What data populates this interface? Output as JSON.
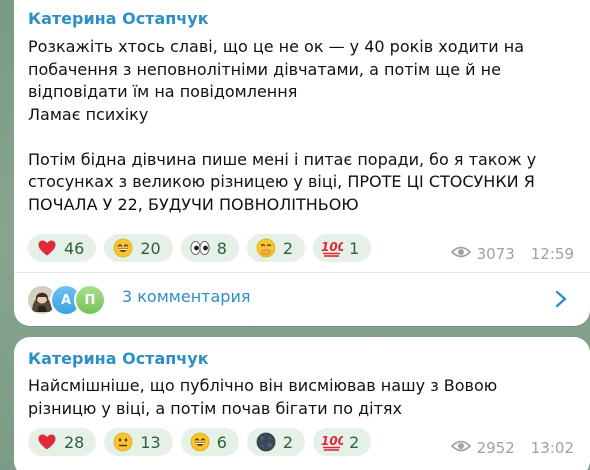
{
  "messages": [
    {
      "sender": "Катерина Остапчук",
      "text": "Розкажіть хтось славі, що це не ок — у 40 років ходити на\nпобачення з неповнолітніми дівчатами, а потім ще й не\nвідповідати їм на повідомлення\nЛамає психіку\n\nПотім бідна дівчина пише мені і питає поради, бо я також у\nстосунках з великою різницею у віці, ПРОТЕ ЦІ СТОСУНКИ Я\nПОЧАЛА У 22, БУДУЧИ ПОВНОЛІТНЬОЮ",
      "reactions": [
        {
          "emoji": "red-heart-icon",
          "count": "46"
        },
        {
          "emoji": "grinning-face-icon",
          "count": "20"
        },
        {
          "emoji": "eyes-icon",
          "count": "8"
        },
        {
          "emoji": "face-with-hand-over-mouth-icon",
          "count": "2"
        },
        {
          "emoji": "hundred-points-icon",
          "count": "1"
        }
      ],
      "views": "3073",
      "time": "12:59",
      "comments": {
        "label": "3 комментария",
        "avatars": [
          "photo",
          "А",
          "П"
        ]
      }
    },
    {
      "sender": "Катерина Остапчук",
      "text": "Найсмішніше, що публічно він висміював нашу з Вовою\nрізницю у віці, а потім почав бігати по дітях",
      "reactions": [
        {
          "emoji": "red-heart-icon",
          "count": "28"
        },
        {
          "emoji": "neutral-face-icon",
          "count": "13"
        },
        {
          "emoji": "grinning-face-icon",
          "count": "6"
        },
        {
          "emoji": "new-moon-face-icon",
          "count": "2"
        },
        {
          "emoji": "hundred-points-icon",
          "count": "2"
        }
      ],
      "views": "2952",
      "time": "13:02"
    }
  ],
  "colors": {
    "sender": "#2d8fc3",
    "reaction_bg": "#e5f1e6",
    "reaction_text": "#2f5f3e",
    "meta": "#9aa3a6",
    "background": "#7f9d89"
  }
}
